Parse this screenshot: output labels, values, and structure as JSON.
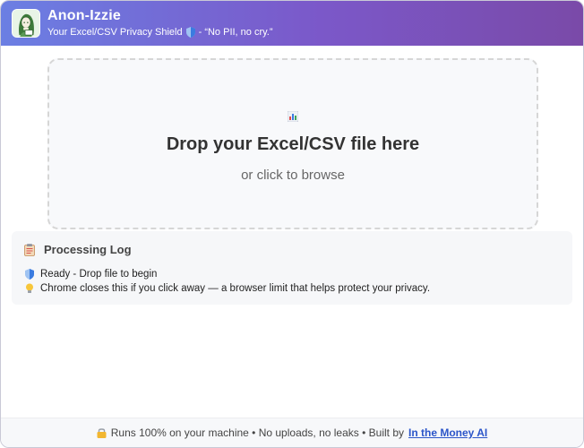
{
  "header": {
    "title": "Anon-Izzie",
    "subtitle_prefix": "Your Excel/CSV Privacy Shield",
    "subtitle_suffix": " - “No PII, no cry.”",
    "logo_icon": "woman-avatar-logo",
    "shield_icon": "shield-icon"
  },
  "dropzone": {
    "icon": "bar-chart-icon",
    "title": "Drop your Excel/CSV file here",
    "subtitle": "or click to browse"
  },
  "log": {
    "icon": "clipboard-icon",
    "title": "Processing Log",
    "lines": [
      {
        "icon": "shield-icon",
        "text": "Ready - Drop file to begin"
      },
      {
        "icon": "lightbulb-icon",
        "text": "Chrome closes this if you click away — a browser limit that helps protect your privacy."
      }
    ]
  },
  "footer": {
    "icon": "lock-icon",
    "text": "Runs 100% on your machine • No uploads, no leaks • Built by",
    "link_text": "In the Money AI"
  },
  "colors": {
    "header_gradient_start": "#6b7fe3",
    "header_gradient_end": "#7a4aa8",
    "link": "#2b55c9"
  }
}
